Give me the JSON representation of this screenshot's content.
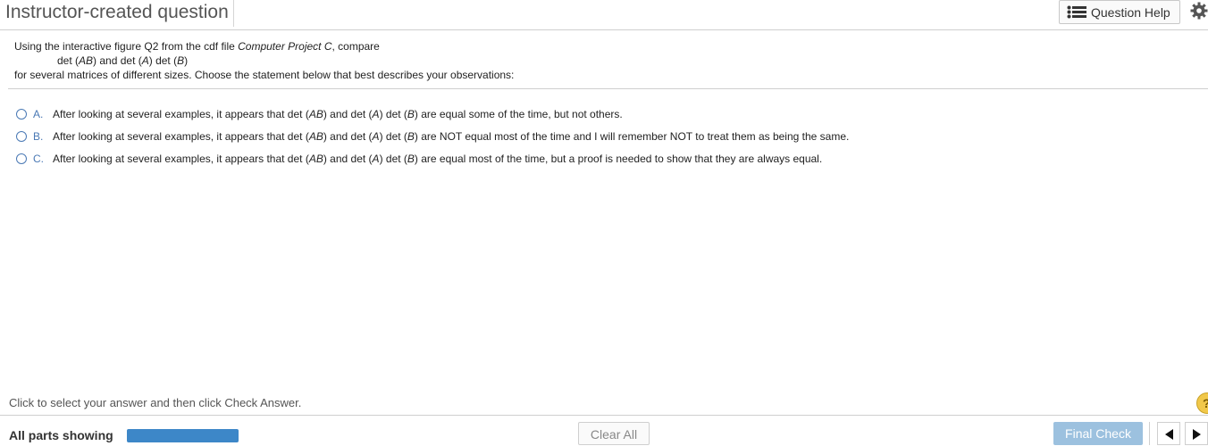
{
  "header": {
    "title": "Instructor-created question",
    "help_label": "Question Help"
  },
  "question": {
    "stem_line1_prefix": "Using the interactive figure Q2 from the cdf file ",
    "stem_line1_file": "Computer Project C",
    "stem_line1_suffix": ", compare",
    "stem_line2_a": "det (",
    "stem_line2_b": "AB",
    "stem_line2_c": ") and det (",
    "stem_line2_d": "A",
    "stem_line2_e": ") det (",
    "stem_line2_f": "B",
    "stem_line2_g": ")",
    "stem_line3": "for several matrices of different sizes.   Choose the statement below that best describes your observations:"
  },
  "options": [
    {
      "letter": "A.",
      "prefix": "After looking at several examples, it appears that det (",
      "ab": "AB",
      "mid": ") and det (",
      "a": "A",
      "mid2": ") det (",
      "b": "B",
      "suffix": ") are equal some of the time, but not others."
    },
    {
      "letter": "B.",
      "prefix": "After looking at several examples, it appears that det (",
      "ab": "AB",
      "mid": ") and det (",
      "a": "A",
      "mid2": ") det (",
      "b": "B",
      "suffix": ") are NOT equal most of the time and I will remember NOT to treat them as being the same."
    },
    {
      "letter": "C.",
      "prefix": "After looking at several examples, it appears that det (",
      "ab": "AB",
      "mid": ") and det (",
      "a": "A",
      "mid2": ") det (",
      "b": "B",
      "suffix": ") are equal most of the time, but a proof is needed to show that they are always equal."
    }
  ],
  "instruction": "Click to select your answer and then click Check Answer.",
  "hint_symbol": "?",
  "footer": {
    "parts_label": "All parts showing",
    "progress_fraction": 1.0,
    "clear_label": "Clear All",
    "final_label": "Final Check"
  },
  "colors": {
    "accent": "#4a79b5",
    "progress": "#3d87c8",
    "final_button": "#9cc1df"
  },
  "icons": [
    "list-icon",
    "gear-icon",
    "hint-icon",
    "triangle-left-icon",
    "triangle-right-icon"
  ]
}
